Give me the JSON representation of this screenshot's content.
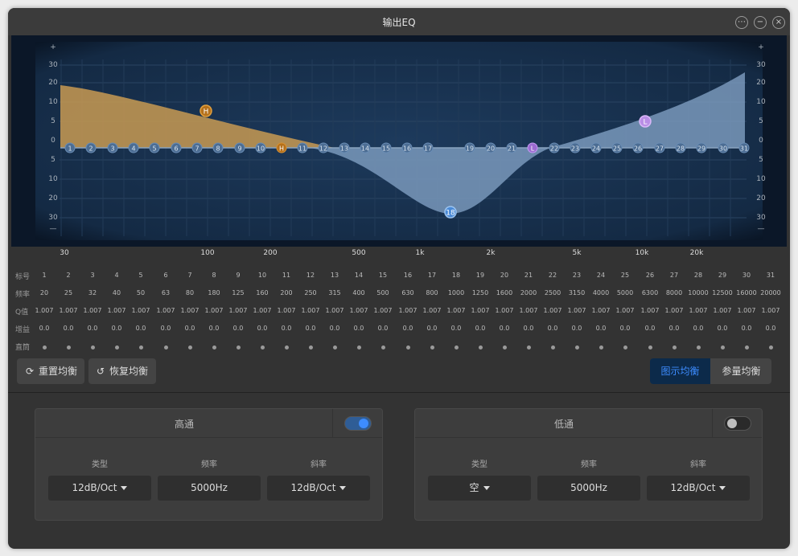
{
  "window": {
    "title": "输出EQ"
  },
  "graph": {
    "left_scale": [
      "+",
      "30",
      "20",
      "10",
      "5",
      "0",
      "5",
      "10",
      "20",
      "30",
      "—"
    ],
    "right_scale": [
      "+",
      "30",
      "20",
      "10",
      "5",
      "0",
      "5",
      "10",
      "20",
      "30",
      "—"
    ],
    "band_markers": [
      "1",
      "2",
      "3",
      "4",
      "5",
      "6",
      "7",
      "8",
      "9",
      "10",
      "H",
      "11",
      "12",
      "13",
      "14",
      "15",
      "16",
      "17",
      "18",
      "19",
      "20",
      "21",
      "L",
      "22",
      "23",
      "24",
      "25",
      "26",
      "27",
      "28",
      "29",
      "30",
      "31"
    ],
    "high_handle": "H",
    "low_handle": "L",
    "peak_handle": "18"
  },
  "freq_axis": [
    "30",
    "100",
    "200",
    "500",
    "1k",
    "2k",
    "5k",
    "10k",
    "20k"
  ],
  "table": {
    "headers": {
      "index": "标号",
      "freq": "频率",
      "q": "Q值",
      "gain": "增益",
      "bypass": "直筒"
    },
    "index": [
      "1",
      "2",
      "3",
      "4",
      "5",
      "6",
      "7",
      "8",
      "9",
      "10",
      "11",
      "12",
      "13",
      "14",
      "15",
      "16",
      "17",
      "18",
      "19",
      "20",
      "21",
      "22",
      "23",
      "24",
      "25",
      "26",
      "27",
      "28",
      "29",
      "30",
      "31"
    ],
    "freq": [
      "20",
      "25",
      "32",
      "40",
      "50",
      "63",
      "80",
      "180",
      "125",
      "160",
      "200",
      "250",
      "315",
      "400",
      "500",
      "630",
      "800",
      "1000",
      "1250",
      "1600",
      "2000",
      "2500",
      "3150",
      "4000",
      "5000",
      "6300",
      "8000",
      "10000",
      "12500",
      "16000",
      "20000"
    ],
    "q": [
      "1.007",
      "1.007",
      "1.007",
      "1.007",
      "1.007",
      "1.007",
      "1.007",
      "1.007",
      "1.007",
      "1.007",
      "1.007",
      "1.007",
      "1.007",
      "1.007",
      "1.007",
      "1.007",
      "1.007",
      "1.007",
      "1.007",
      "1.007",
      "1.007",
      "1.007",
      "1.007",
      "1.007",
      "1.007",
      "1.007",
      "1.007",
      "1.007",
      "1.007",
      "1.007",
      "1.007"
    ],
    "gain": [
      "0.0",
      "0.0",
      "0.0",
      "0.0",
      "0.0",
      "0.0",
      "0.0",
      "0.0",
      "0.0",
      "0.0",
      "0.0",
      "0.0",
      "0.0",
      "0.0",
      "0.0",
      "0.0",
      "0.0",
      "0.0",
      "0.0",
      "0.0",
      "0.0",
      "0.0",
      "0.0",
      "0.0",
      "0.0",
      "0.0",
      "0.0",
      "0.0",
      "0.0",
      "0.0",
      "0.0"
    ]
  },
  "buttons": {
    "reset": "重置均衡",
    "restore": "恢复均衡",
    "graphic": "图示均衡",
    "parametric": "参量均衡"
  },
  "highpass": {
    "title": "高通",
    "enabled": true,
    "type_label": "类型",
    "type": "12dB/Oct",
    "freq_label": "频率",
    "freq": "5000Hz",
    "slope_label": "斜率",
    "slope": "12dB/Oct"
  },
  "lowpass": {
    "title": "低通",
    "enabled": false,
    "type_label": "类型",
    "type": "空",
    "freq_label": "频率",
    "freq": "5000Hz",
    "slope_label": "斜率",
    "slope": "12dB/Oct"
  },
  "colors": {
    "accent": "#3d8cff",
    "highpass_fill": "#c89a52",
    "lowpass_marker": "#b98ee6",
    "curve_fill": "#7f9fc2"
  }
}
